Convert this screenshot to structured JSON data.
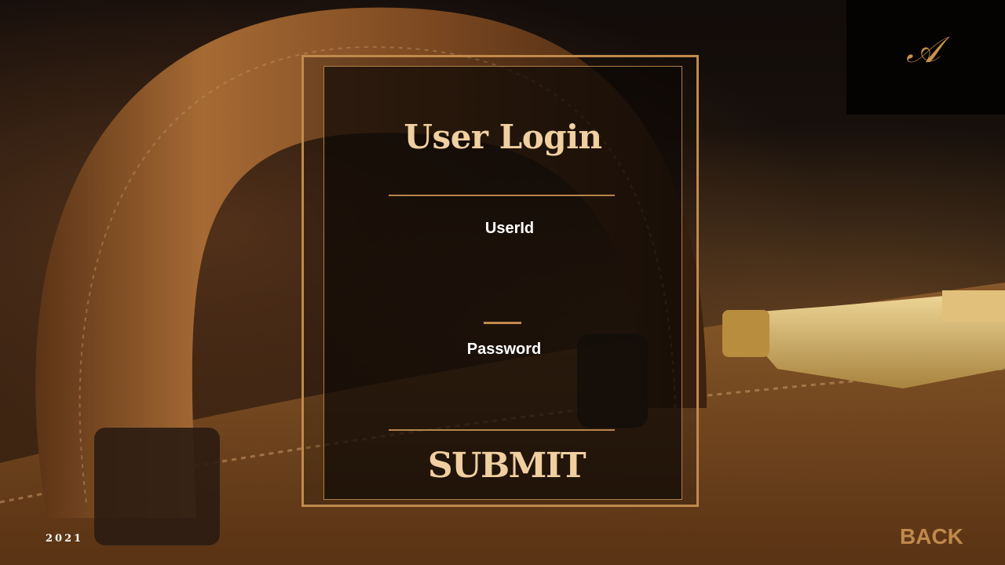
{
  "login": {
    "title": "User Login",
    "userid_label": "UserId",
    "userid_value": "",
    "password_label": "Password",
    "password_value": "",
    "submit_label": "SUBMIT"
  },
  "footer": {
    "year": "2021"
  },
  "nav": {
    "back_label": "BACK"
  },
  "brand": {
    "mark_icon": "as-monogram-logo-icon"
  },
  "colors": {
    "accent": "#c08a4d",
    "title": "#f0cfa0",
    "text": "#ffffff",
    "panel": "#0c0704"
  }
}
